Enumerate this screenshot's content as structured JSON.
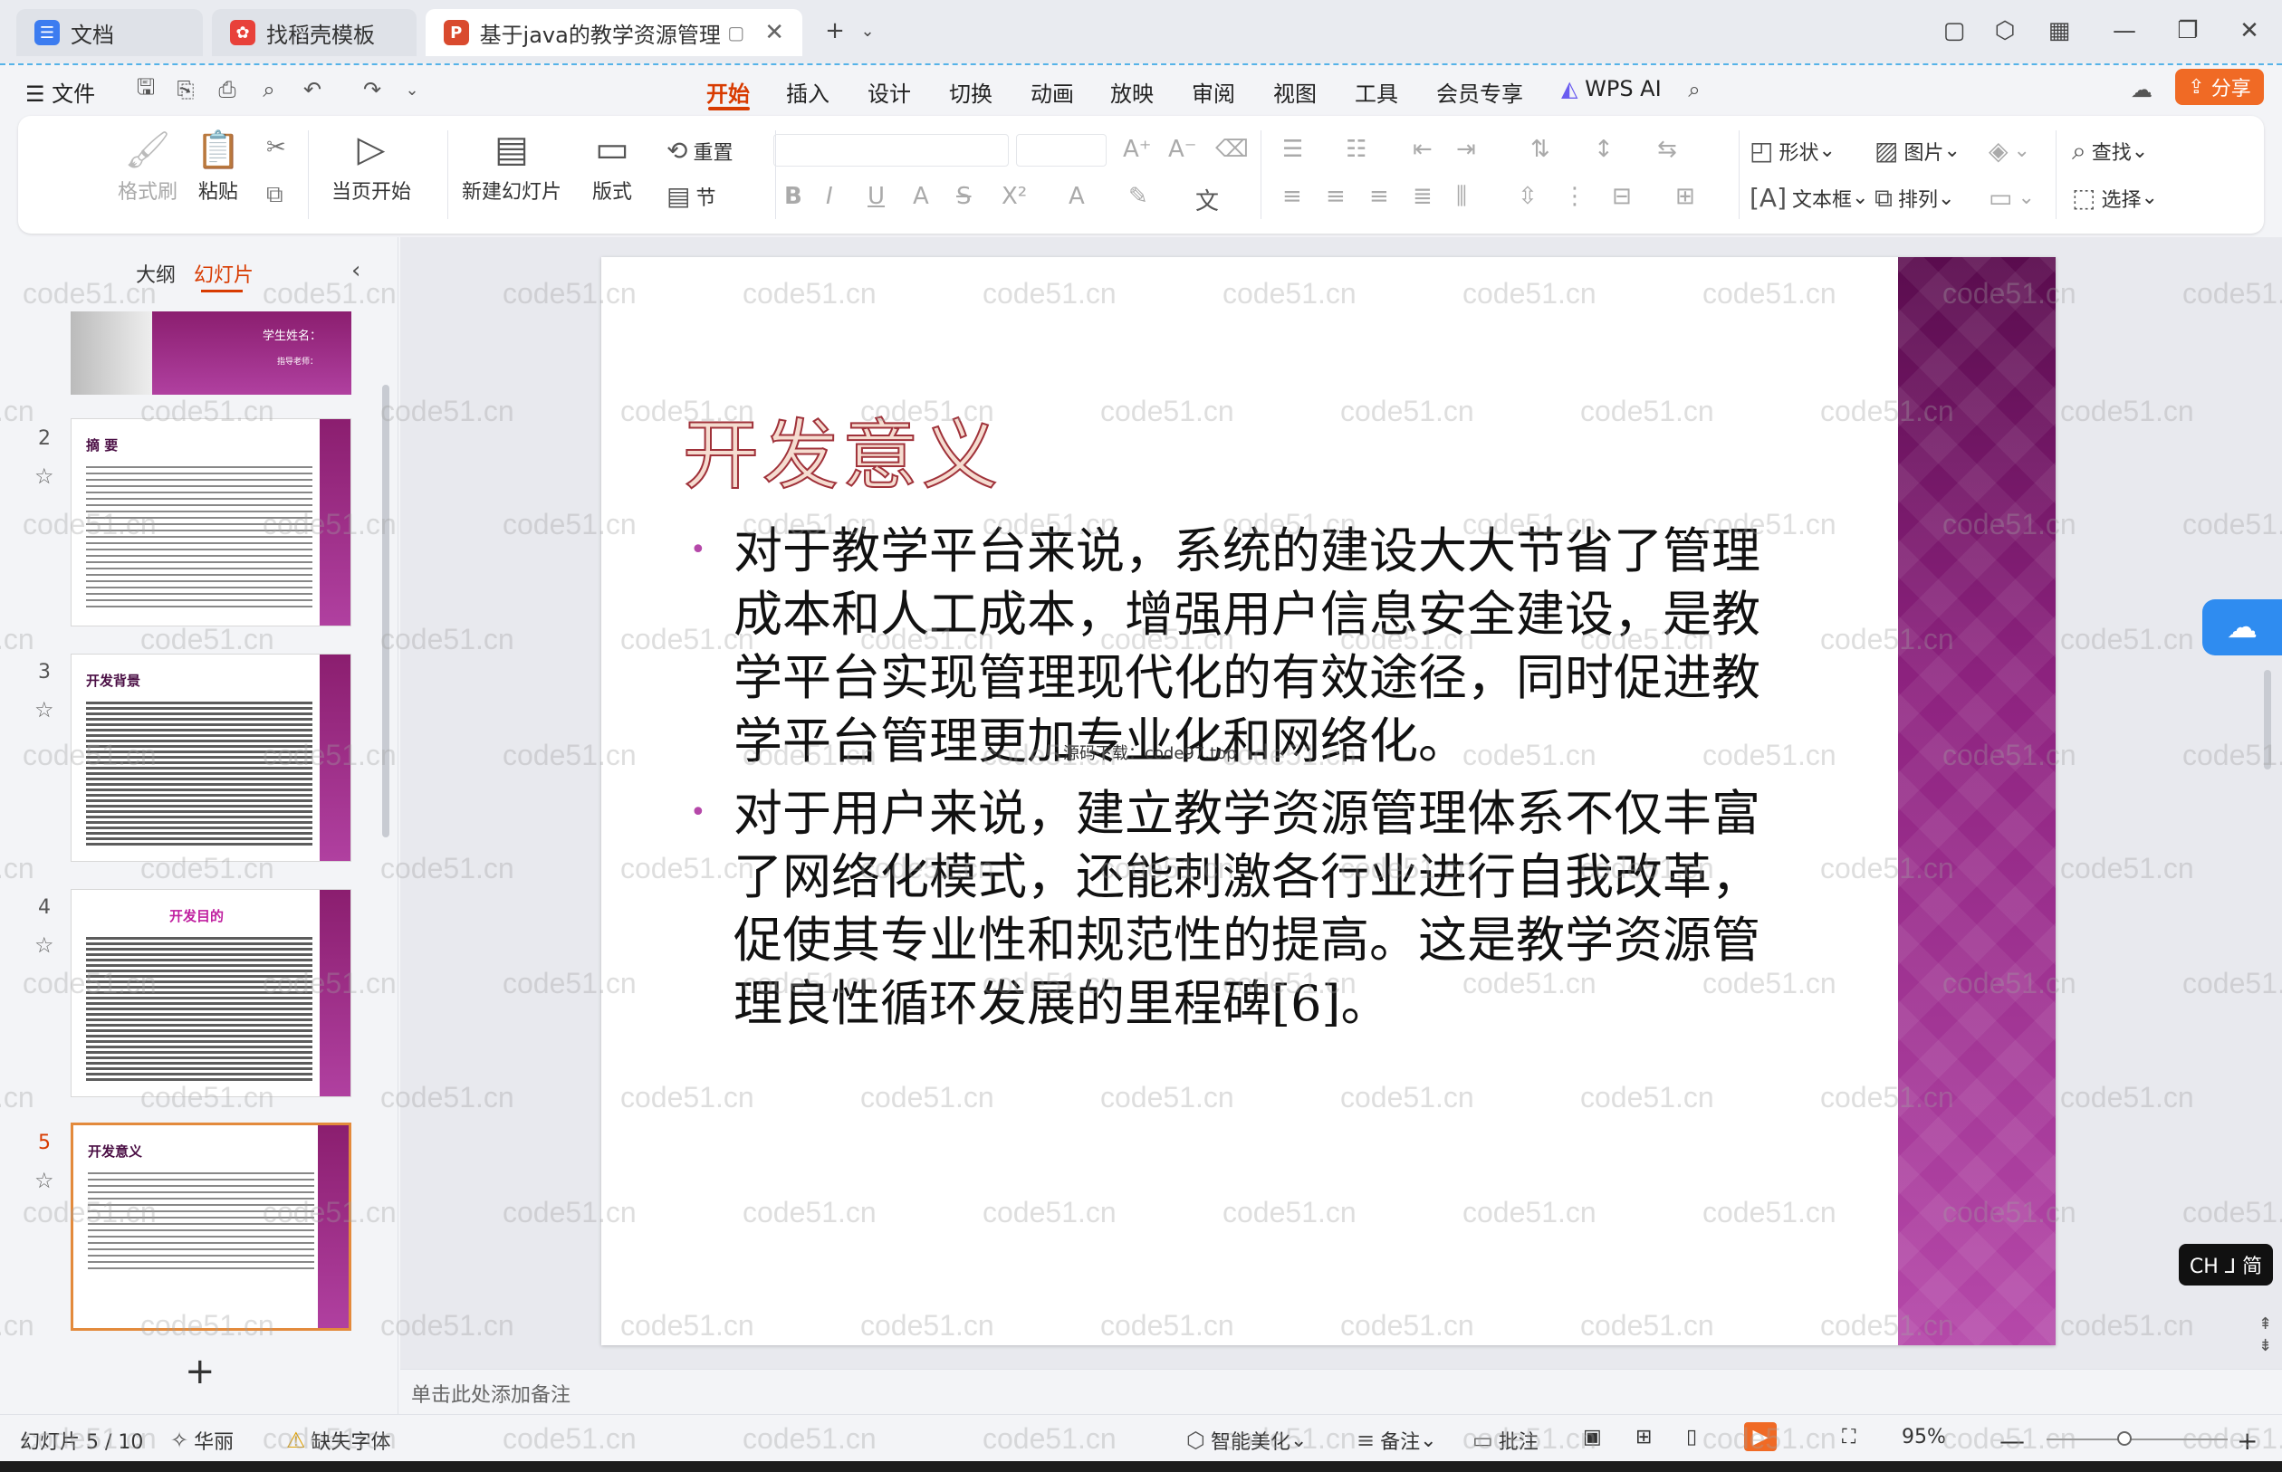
{
  "tabs": [
    {
      "label": "文档",
      "icon": "doc-icon",
      "color": "#3c7cf0"
    },
    {
      "label": "找稻壳模板",
      "icon": "docer-icon",
      "color": "#e8413a"
    },
    {
      "label": "基于java的教学资源管理系统",
      "icon": "ppt-icon",
      "color": "#d94a2e",
      "active": true
    }
  ],
  "menu": {
    "file": "文件",
    "items": [
      "开始",
      "插入",
      "设计",
      "切换",
      "动画",
      "放映",
      "审阅",
      "视图",
      "工具",
      "会员专享"
    ],
    "active_index": 0,
    "wps_ai": "WPS AI",
    "share": "分享"
  },
  "ribbon": {
    "format_painter": "格式刷",
    "paste": "粘贴",
    "play_from_current": "当页开始",
    "new_slide": "新建幻灯片",
    "layout": "版式",
    "reset": "重置",
    "section": "节",
    "shape": "形状",
    "picture": "图片",
    "textbox": "文本框",
    "arrange": "排列",
    "find": "查找",
    "select": "选择"
  },
  "left_panel": {
    "tab_outline": "大纲",
    "tab_slides": "幻灯片",
    "thumbs": [
      {
        "num": "",
        "title": "学生姓名：",
        "subtitle": "指导老师："
      },
      {
        "num": "2",
        "title": "摘  要"
      },
      {
        "num": "3",
        "title": "开发背景"
      },
      {
        "num": "4",
        "title": "开发目的"
      },
      {
        "num": "5",
        "title": "开发意义",
        "current": true
      }
    ],
    "add_label": "+"
  },
  "slide": {
    "title": "开发意义",
    "bullets": [
      "对于教学平台来说，系统的建设大大节省了管理成本和人工成本，增强用户信息安全建设，是教学平台实现管理现代化的有效途径，同时促进教学平台管理更加专业化和网络化。",
      "对于用户来说，建立教学资源管理体系不仅丰富了网络化模式，还能刺激各行业进行自我改革，促使其专业性和规范性的提高。这是教学资源管理良性循环发展的里程碑[6]。"
    ],
    "overlay": "源码下载：code97.top",
    "accent_color": "#8e2380"
  },
  "notes_placeholder": "单击此处添加备注",
  "status": {
    "slide_info": "幻灯片 5 / 10",
    "theme": "华丽",
    "missing_font": "缺失字体",
    "beautify": "智能美化",
    "notes": "备注",
    "comments": "批注",
    "zoom": "95%"
  },
  "ime": "CH ⅃ 简",
  "watermark": "code51.cn"
}
